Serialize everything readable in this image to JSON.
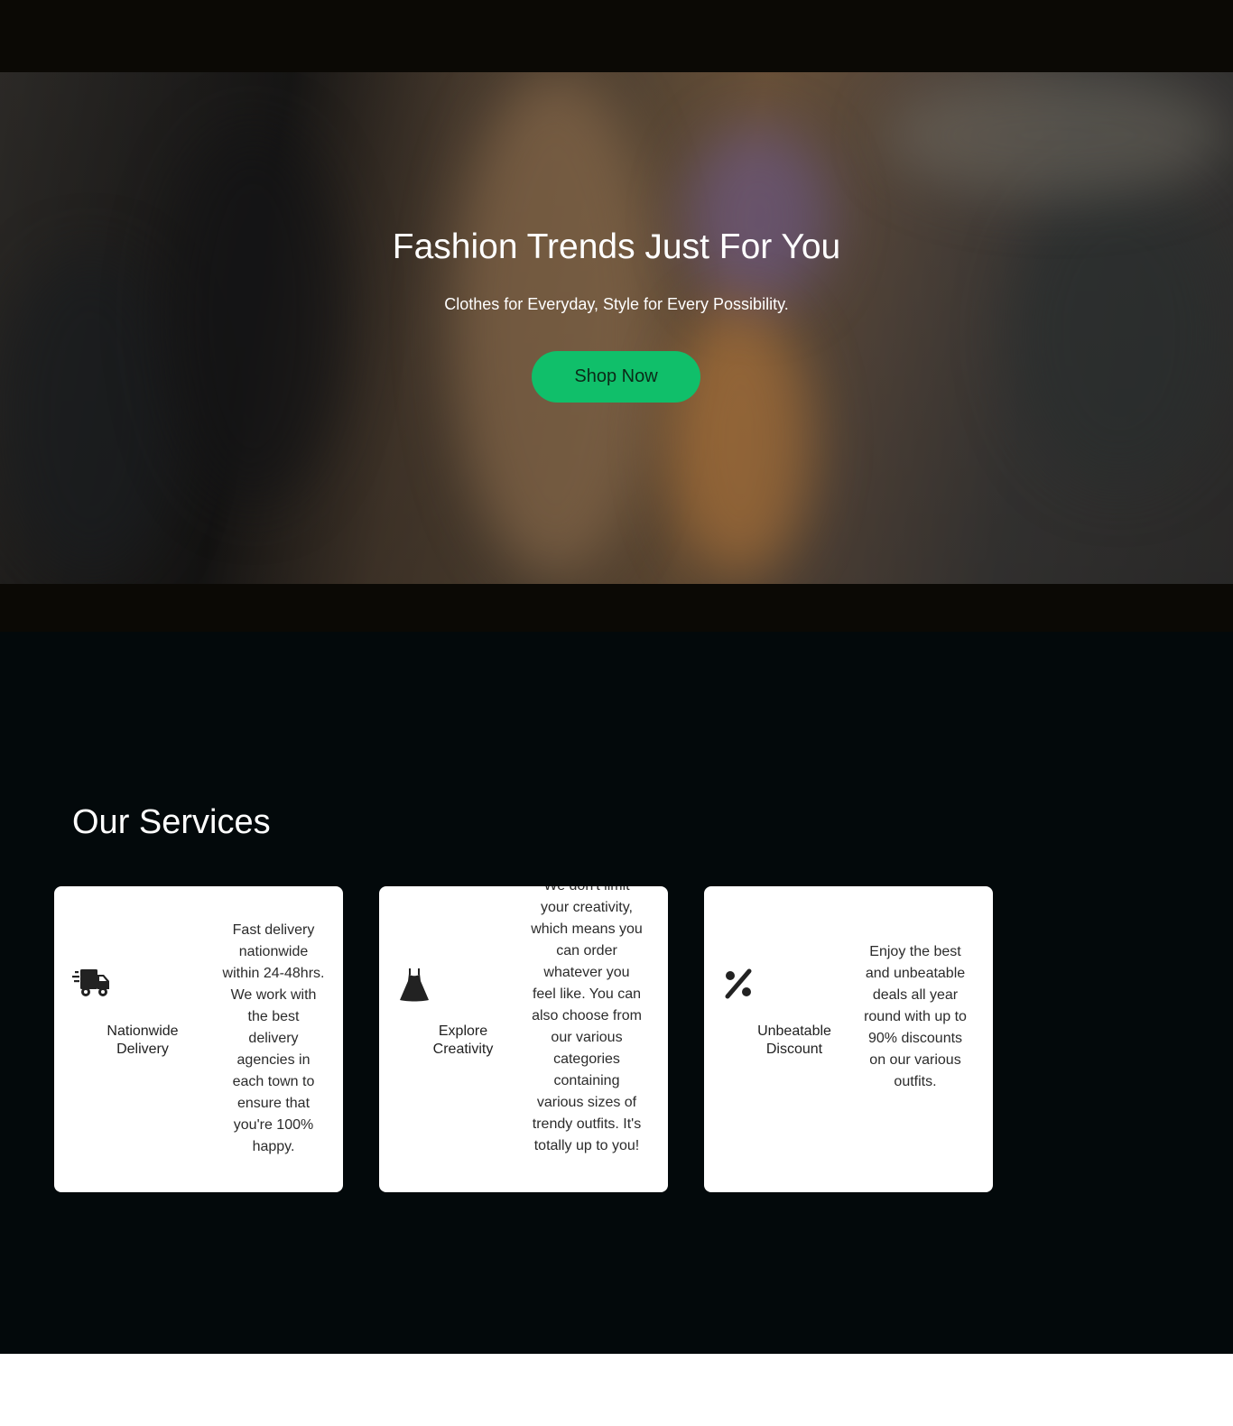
{
  "hero": {
    "title": "Fashion Trends Just For You",
    "subtitle": "Clothes for Everyday, Style for Every Possibility.",
    "cta_label": "Shop Now",
    "cta_color": "#10bf6a"
  },
  "services": {
    "title": "Our Services",
    "items": [
      {
        "icon": "delivery-truck-icon",
        "label": "Nationwide Delivery",
        "description": "Fast delivery nationwide within 24-48hrs. We work with the best delivery agencies in each town to ensure that you're 100% happy."
      },
      {
        "icon": "dress-icon",
        "label": "Explore Creativity",
        "description": "We don't limit your creativity, which means you can order whatever you feel like. You can also choose from our various categories containing various sizes of trendy outfits. It's totally up to you!"
      },
      {
        "icon": "percent-icon",
        "label": "Unbeatable Discount",
        "description": "Enjoy the best and unbeatable deals all year round with up to 90% discounts on our various outfits."
      }
    ]
  }
}
